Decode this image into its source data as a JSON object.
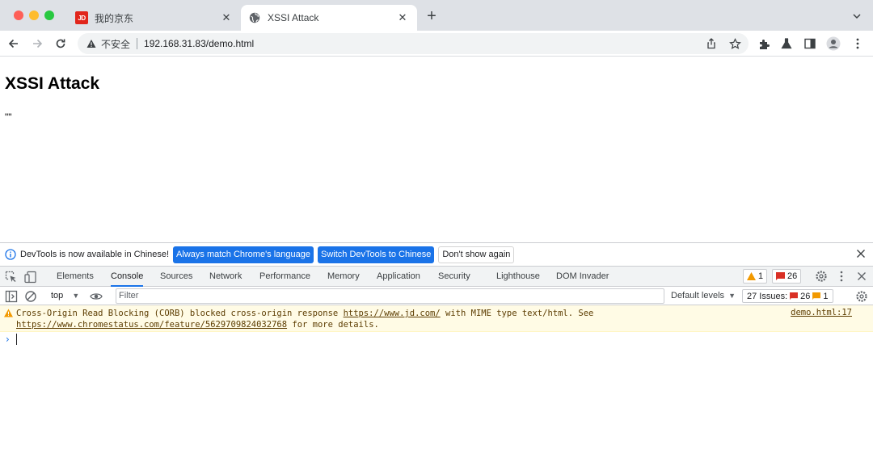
{
  "browser": {
    "tabs": [
      {
        "title": "我的京东",
        "favicon": "JD"
      },
      {
        "title": "XSSI Attack",
        "favicon": "globe-icon"
      }
    ],
    "address": {
      "security_label": "不安全",
      "url": "192.168.31.83/demo.html"
    }
  },
  "page": {
    "heading": "XSSI Attack",
    "body_text": "\"\""
  },
  "devtools": {
    "infobar": {
      "message": "DevTools is now available in Chinese!",
      "match_button": "Always match Chrome's language",
      "switch_button": "Switch DevTools to Chinese",
      "dismiss_button": "Don't show again"
    },
    "tabs": [
      "Elements",
      "Console",
      "Sources",
      "Network",
      "Performance",
      "Memory",
      "Application",
      "Security",
      "Lighthouse",
      "DOM Invader"
    ],
    "active_tab": "Console",
    "warnings_count": "1",
    "errors_count": "26",
    "toolbar": {
      "context": "top",
      "filter_placeholder": "Filter",
      "levels": "Default levels",
      "issues_label": "27 Issues:",
      "issues_errors": "26",
      "issues_warnings": "1"
    },
    "console_messages": [
      {
        "level": "warning",
        "text_1": "Cross-Origin Read Blocking (CORB) blocked cross-origin response ",
        "link_1": "https://www.jd.com/",
        "text_2": " with MIME type text/html. See ",
        "link_2": "https://www.chromestatus.com/feature/5629709824032768",
        "text_3": " for more details.",
        "source": "demo.html:17"
      }
    ]
  },
  "colors": {
    "accent": "#1a73e8",
    "warning": "#f29900",
    "error": "#d93025"
  }
}
